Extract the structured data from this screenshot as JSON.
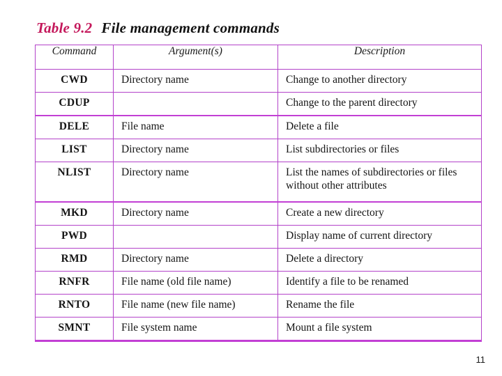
{
  "slide": {
    "title_number": "Table 9.2",
    "title_text": "File management commands",
    "title_number_color": "#C4185B",
    "title_text_color": "#121212",
    "page_number": "11"
  },
  "table": {
    "border_color": "#B342C9",
    "header_background": "#FBE7FB",
    "columns": [
      {
        "key": "command",
        "label": "Command"
      },
      {
        "key": "arguments",
        "label": "Argument(s)"
      },
      {
        "key": "description",
        "label": "Description"
      }
    ],
    "rows": [
      {
        "command": "CWD",
        "arguments": "Directory name",
        "description": "Change to another directory"
      },
      {
        "command": "CDUP",
        "arguments": "",
        "description": "Change to the parent directory"
      },
      {
        "command": "DELE",
        "arguments": "File name",
        "description": "Delete a file"
      },
      {
        "command": "LIST",
        "arguments": "Directory name",
        "description": "List subdirectories or files"
      },
      {
        "command": "NLIST",
        "arguments": "Directory name",
        "description": "List the names of subdirectories or files without other attributes"
      },
      {
        "command": "MKD",
        "arguments": "Directory name",
        "description": "Create a new directory"
      },
      {
        "command": "PWD",
        "arguments": "",
        "description": "Display name of current directory"
      },
      {
        "command": "RMD",
        "arguments": "Directory name",
        "description": "Delete a directory"
      },
      {
        "command": "RNFR",
        "arguments": "File name (old file name)",
        "description": "Identify a file to be renamed"
      },
      {
        "command": "RNTO",
        "arguments": "File name (new file name)",
        "description": "Rename the file"
      },
      {
        "command": "SMNT",
        "arguments": "File system name",
        "description": "Mount a file system"
      }
    ]
  }
}
